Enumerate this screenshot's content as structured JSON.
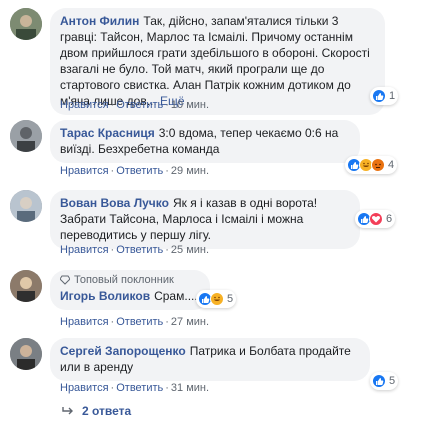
{
  "comments": [
    {
      "author": "Антон Филин",
      "text": "Так, дійсно, запам'яталися тільки 3 гравці: Тайсон, Марлос та Ісмаілі. Причому останнім двом прийшлося грати здебільшого в обороні. Скорості взагалі не було. Той матч, який програли ще до стартового свистка. Алан Патрік кожним дотиком до м'яча лише дов...",
      "more": "Ещё",
      "like": "Нравится",
      "reply": "Ответить",
      "time": "10 мин.",
      "reaction_count": "1",
      "reactions": [
        "like"
      ]
    },
    {
      "author": "Тарас Красниця",
      "text": "3:0 вдома, тепер чекаємо 0:6 на виїзді. Безхребетна команда",
      "like": "Нравится",
      "reply": "Ответить",
      "time": "29 мин.",
      "reaction_count": "4",
      "reactions": [
        "like",
        "haha",
        "angry"
      ]
    },
    {
      "author": "Вован Вова Лучко",
      "text": "Як я і казав в одні ворота! Забрати Тайсона, Марлоса і Ісмаілі і можна переводитись у першу лігу.",
      "like": "Нравится",
      "reply": "Ответить",
      "time": "25 мин.",
      "reaction_count": "6",
      "reactions": [
        "like",
        "love"
      ]
    },
    {
      "badge": "Топовый поклонник",
      "author": "Игорь Воликов",
      "text": "Срам....",
      "like": "Нравится",
      "reply": "Ответить",
      "time": "27 мин.",
      "reaction_count": "5",
      "reactions": [
        "like",
        "haha"
      ]
    },
    {
      "author": "Сергей Запорощенко",
      "text": "Патрика и Болбата продайте или в аренду",
      "like": "Нравится",
      "reply": "Ответить",
      "time": "31 мин.",
      "reaction_count": "5",
      "reactions": [
        "like"
      ]
    }
  ],
  "replies_label": "2 ответа",
  "colors": {
    "link": "#385898",
    "bubble": "#f2f3f5",
    "meta": "#606770",
    "like": "#1877f2"
  }
}
